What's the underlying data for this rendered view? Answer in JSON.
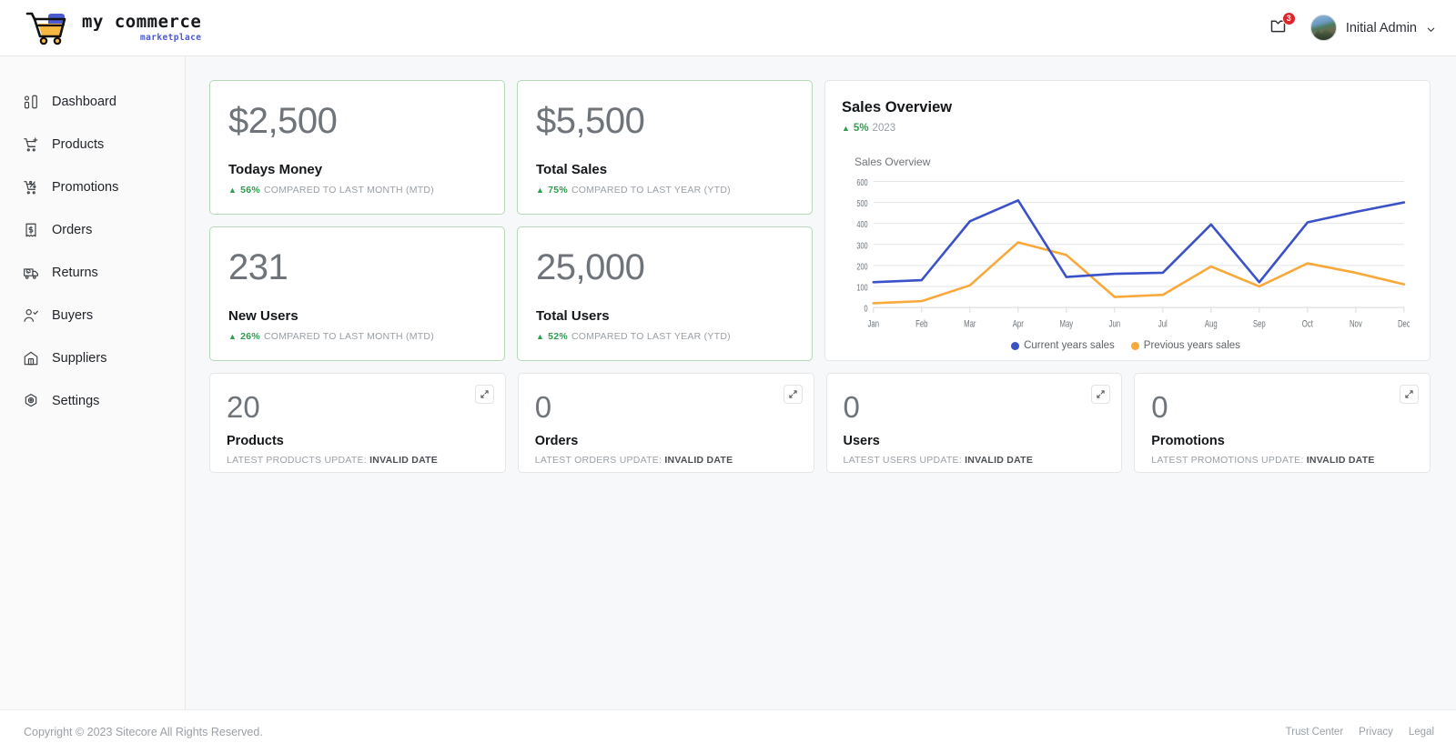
{
  "header": {
    "brand_title": "my commerce",
    "brand_sub": "marketplace",
    "brand_icon": "shopping-cart-logo",
    "notifications_icon": "inbox-icon",
    "notifications_count": "3",
    "user_name": "Initial Admin",
    "caret_icon": "chevron-down-icon",
    "avatar_icon": "user-avatar"
  },
  "sidebar": {
    "items": [
      {
        "label": "Dashboard",
        "icon": "dashboard-icon"
      },
      {
        "label": "Products",
        "icon": "cart-plus-icon"
      },
      {
        "label": "Promotions",
        "icon": "cart-percent-icon"
      },
      {
        "label": "Orders",
        "icon": "receipt-icon"
      },
      {
        "label": "Returns",
        "icon": "truck-return-icon"
      },
      {
        "label": "Buyers",
        "icon": "user-check-icon"
      },
      {
        "label": "Suppliers",
        "icon": "warehouse-icon"
      },
      {
        "label": "Settings",
        "icon": "gear-icon"
      }
    ]
  },
  "stats": [
    {
      "value": "$2,500",
      "title": "Todays Money",
      "arrow": "▲",
      "pct": "56%",
      "meta": "COMPARED TO LAST MONTH (MTD)"
    },
    {
      "value": "$5,500",
      "title": "Total Sales",
      "arrow": "▲",
      "pct": "75%",
      "meta": "COMPARED TO LAST YEAR (YTD)"
    },
    {
      "value": "231",
      "title": "New Users",
      "arrow": "▲",
      "pct": "26%",
      "meta": "COMPARED TO LAST MONTH (MTD)"
    },
    {
      "value": "25,000",
      "title": "Total Users",
      "arrow": "▲",
      "pct": "52%",
      "meta": "COMPARED TO LAST YEAR (YTD)"
    }
  ],
  "sales_card": {
    "title": "Sales Overview",
    "arrow": "▲",
    "pct": "5%",
    "year": "2023",
    "caption": "Sales Overview"
  },
  "mini_cards": [
    {
      "value": "20",
      "title": "Products",
      "meta_prefix": "LATEST PRODUCTS UPDATE: ",
      "meta_value": "INVALID DATE",
      "expand_icon": "expand-icon"
    },
    {
      "value": "0",
      "title": "Orders",
      "meta_prefix": "LATEST ORDERS UPDATE: ",
      "meta_value": "INVALID DATE",
      "expand_icon": "expand-icon"
    },
    {
      "value": "0",
      "title": "Users",
      "meta_prefix": "LATEST USERS UPDATE: ",
      "meta_value": "INVALID DATE",
      "expand_icon": "expand-icon"
    },
    {
      "value": "0",
      "title": "Promotions",
      "meta_prefix": "LATEST PROMOTIONS UPDATE: ",
      "meta_value": "INVALID DATE",
      "expand_icon": "expand-icon"
    }
  ],
  "footer": {
    "copyright": "Copyright © 2023 Sitecore All Rights Reserved.",
    "links": [
      "Trust Center",
      "Privacy",
      "Legal"
    ]
  },
  "colors": {
    "accent_blue": "#3b51c8",
    "accent_orange": "#f9a83a",
    "positive_green": "#2e9e4f",
    "card_border_green": "#b6d8b9",
    "badge_red": "#e0252a",
    "page_bg": "#f7f8f9"
  },
  "chart_data": {
    "type": "line",
    "title": "Sales Overview",
    "xlabel": "",
    "ylabel": "",
    "ylim": [
      0,
      600
    ],
    "yticks": [
      0,
      100,
      200,
      300,
      400,
      500,
      600
    ],
    "grid": true,
    "legend_position": "bottom",
    "categories": [
      "Jan",
      "Feb",
      "Mar",
      "Apr",
      "May",
      "Jun",
      "Jul",
      "Aug",
      "Sep",
      "Oct",
      "Nov",
      "Dec"
    ],
    "series": [
      {
        "name": "Current years sales",
        "color": "#3b51c8",
        "values": [
          120,
          130,
          410,
          510,
          145,
          160,
          165,
          395,
          120,
          405,
          455,
          500
        ]
      },
      {
        "name": "Previous years sales",
        "color": "#f9a83a",
        "values": [
          20,
          30,
          105,
          310,
          250,
          50,
          60,
          195,
          100,
          210,
          165,
          110
        ]
      }
    ]
  }
}
